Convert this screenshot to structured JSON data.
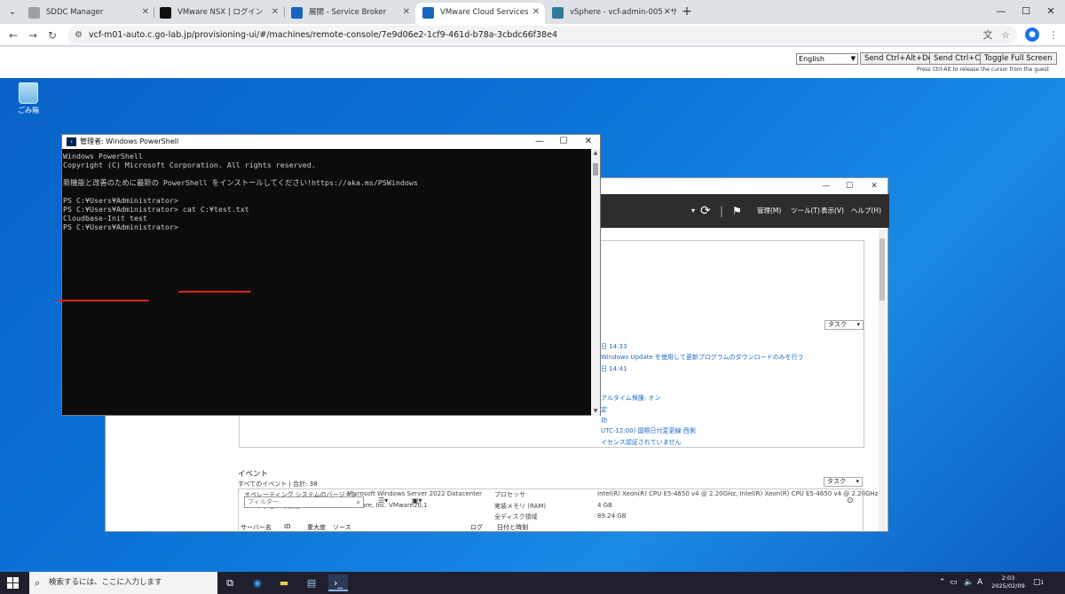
{
  "browser": {
    "tabs": [
      {
        "label": "SDDC Manager",
        "color": "#5f6368"
      },
      {
        "label": "VMware NSX | ログイン",
        "color": "#111111"
      },
      {
        "label": "展開 - Service Broker",
        "color": "#1565c0"
      },
      {
        "label": "VMware Cloud Services",
        "color": "#1565c0"
      },
      {
        "label": "vSphere - vcf-admin-005 - サマ",
        "color": "#2e7d9a"
      }
    ],
    "url": "vcf-m01-auto.c.go-lab.jp/provisioning-ui/#/machines/remote-console/7e9d06e2-1cf9-461d-b78a-3cbdc66f38e4"
  },
  "console": {
    "language": "English",
    "buttons": [
      "Send Ctrl+Alt+Del",
      "Send Ctrl+C",
      "Toggle Full Screen"
    ],
    "hint": "Press Ctrl-Alt to release the cursor from the guest"
  },
  "desktop": {
    "recycle_label": "ごみ箱"
  },
  "powershell": {
    "title": "管理者: Windows PowerShell",
    "lines": [
      "Windows PowerShell",
      "Copyright (C) Microsoft Corporation. All rights reserved.",
      "",
      "新機能と改善のために最新の PowerShell をインストールしてください!https://aka.ms/PSWindows",
      "",
      "PS C:¥Users¥Administrator>",
      "PS C:¥Users¥Administrator> cat C:¥test.txt",
      "Cloudbase-Init test",
      "PS C:¥Users¥Administrator>"
    ]
  },
  "server_manager": {
    "menu": [
      "管理(M)",
      "ツール(T)",
      "表示(V)",
      "ヘルプ(H)"
    ],
    "task_label": "タスク",
    "props_right": [
      {
        "text": "日 14:33",
        "link": true
      },
      {
        "text": "Windows Update を使用して更新プログラムのダウンロードのみを行う",
        "link": true
      },
      {
        "text": "日 14:41",
        "link": true
      },
      {
        "text": "アルタイム保護: オン",
        "link": true
      },
      {
        "text": "定",
        "link": true
      },
      {
        "text": "効",
        "link": true
      },
      {
        "text": "UTC-12:00) 国際日付変更線 西側",
        "link": true
      },
      {
        "text": "イセンス認証されていません",
        "link": true
      }
    ],
    "props_bottom": [
      [
        "オペレーティング システムのバージョン",
        "Microsoft Windows Server 2022 Datacenter",
        "プロセッサ",
        "Intel(R) Xeon(R) CPU E5-4650 v4 @ 2.20GHz, Intel(R) Xeon(R) CPU E5-4650 v4 @ 2.20GHz"
      ],
      [
        "ハードウェアの情報",
        "VMware, Inc. VMware20,1",
        "実装メモリ (RAM)",
        "4 GB"
      ],
      [
        "",
        "",
        "全ディスク領域",
        "89.24 GB"
      ]
    ],
    "events_title": "イベント",
    "events_sub": "すべてのイベント | 合計: 38",
    "filter_placeholder": "フィルター",
    "columns": [
      "サーバー名",
      "ID",
      "重大度",
      "ソース",
      "ログ",
      "日付と時刻"
    ]
  },
  "taskbar": {
    "search_placeholder": "検索するには、ここに入力します",
    "time": "2:03",
    "date": "2025/02/09",
    "ime": "A",
    "notify_count": "1"
  }
}
